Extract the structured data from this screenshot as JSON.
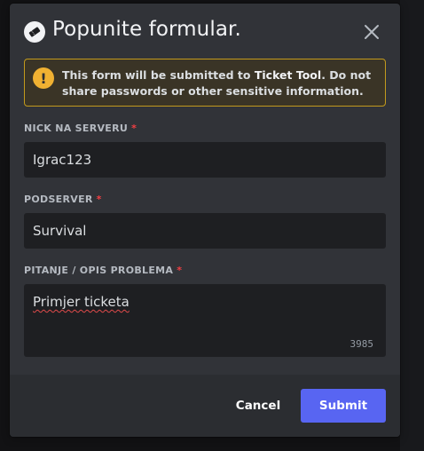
{
  "modal": {
    "title": "Popunite formular.",
    "icon": "ticket-icon"
  },
  "warning": {
    "text_before": "This form will be submitted to ",
    "app_name": "Ticket Tool",
    "text_after": ". Do not share passwords or other sensitive information."
  },
  "fields": [
    {
      "label": "NICK NA SERVERU",
      "required_mark": "*",
      "value": "Igrac123"
    },
    {
      "label": "PODSERVER",
      "required_mark": "*",
      "value": "Survival"
    },
    {
      "label": "PITANJE / OPIS PROBLEMA",
      "required_mark": "*",
      "value": "Primjer ticketa",
      "counter": "3985"
    }
  ],
  "footer": {
    "cancel_label": "Cancel",
    "submit_label": "Submit"
  },
  "colors": {
    "accent": "#5865f2",
    "warning_border": "#c29a1d",
    "required": "#f23f43"
  }
}
